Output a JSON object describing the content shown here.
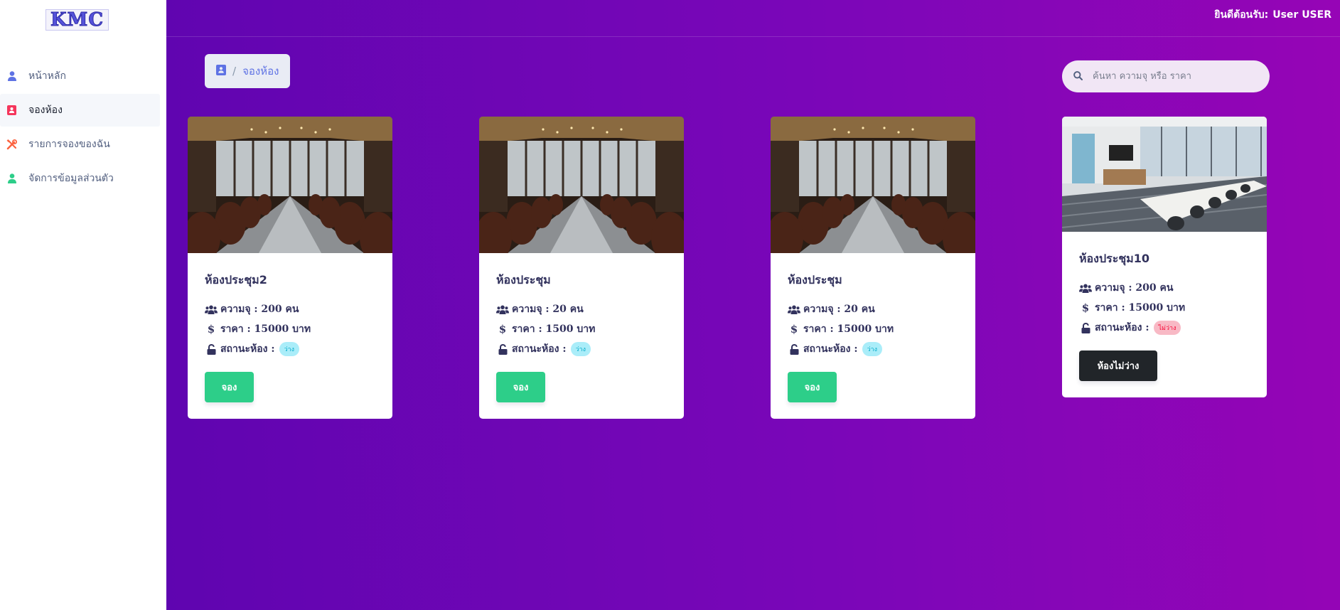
{
  "logo": {
    "text": "KMC"
  },
  "header": {
    "welcome_label": "ยินดีต้อนรับ:",
    "user_name": "User USER"
  },
  "sidebar": {
    "items": [
      {
        "label": "หน้าหลัก",
        "icon": "user-icon",
        "color": "#5e72e4",
        "active": false
      },
      {
        "label": "จองห้อง",
        "icon": "contact-book-icon",
        "color": "#f5365c",
        "active": true
      },
      {
        "label": "รายการจองของฉัน",
        "icon": "tools-icon",
        "color": "#fb6340",
        "active": false
      },
      {
        "label": "จัดการข้อมูลส่วนตัว",
        "icon": "user-icon",
        "color": "#2dce89",
        "active": false
      }
    ]
  },
  "breadcrumb": {
    "icon": "contact-book-icon",
    "separator": "/",
    "current": "จองห้อง"
  },
  "search": {
    "placeholder": "ค้นหา ความจุ หรือ ราคา",
    "value": ""
  },
  "rooms": [
    {
      "name": "ห้องประชุม2",
      "capacity": "ความจุ : 200 คน",
      "price": "ราคา : 15000 บาท",
      "status_label": "สถานะห้อง :",
      "status": "ว่าง",
      "available": true,
      "action": "จอง",
      "photo": "boardroom"
    },
    {
      "name": "ห้องประชุม",
      "capacity": "ความจุ : 20 คน",
      "price": "ราคา : 1500 บาท",
      "status_label": "สถานะห้อง :",
      "status": "ว่าง",
      "available": true,
      "action": "จอง",
      "photo": "boardroom"
    },
    {
      "name": "ห้องประชุม",
      "capacity": "ความจุ : 20 คน",
      "price": "ราคา : 15000 บาท",
      "status_label": "สถานะห้อง :",
      "status": "ว่าง",
      "available": true,
      "action": "จอง",
      "photo": "boardroom"
    },
    {
      "name": "ห้องประชุม10",
      "capacity": "ความจุ : 200 คน",
      "price": "ราคา : 15000 บาท",
      "status_label": "สถานะห้อง :",
      "status": "ไม่ว่าง",
      "available": false,
      "action": "ห้องไม่ว่าง",
      "photo": "office"
    }
  ],
  "colors": {
    "accent": "#5e72e4",
    "success": "#2dce89",
    "danger": "#f5365c",
    "info": "#11cdef",
    "dark": "#212529",
    "gradient_start": "#5f05b0",
    "gradient_end": "#9605b6"
  }
}
